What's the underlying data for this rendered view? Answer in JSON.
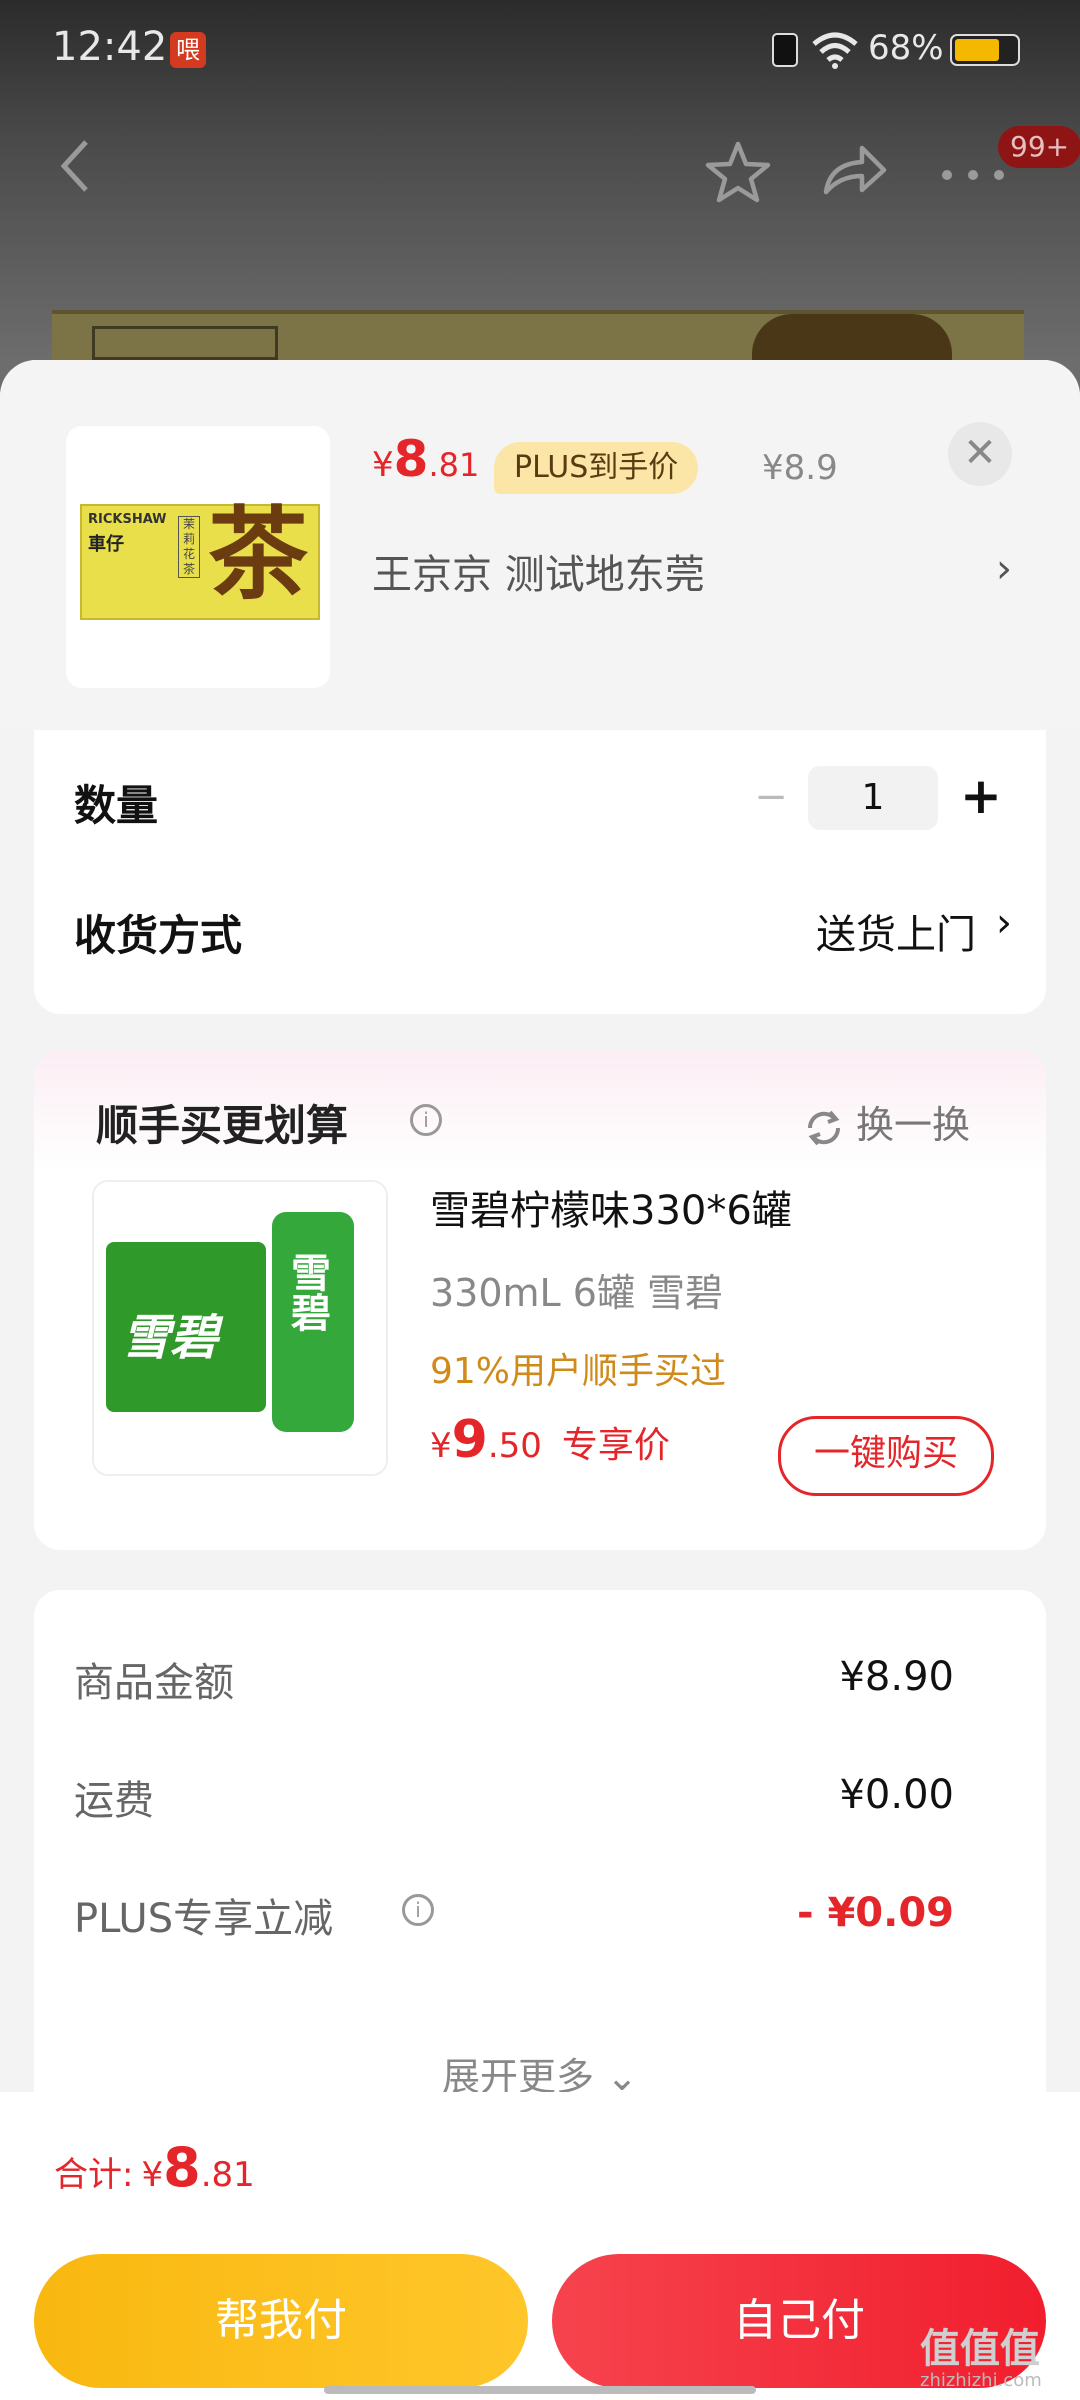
{
  "status_bar": {
    "time": "12:42",
    "app_badge": "喂",
    "battery": "68%"
  },
  "nav": {
    "more_badge": "99+"
  },
  "product": {
    "thumb_brand": "RICKSHAW",
    "thumb_cn": "車仔",
    "thumb_label": "茉莉花茶",
    "thumb_big": "茶",
    "price_currency": "¥",
    "price_int": "8",
    "price_dec": ".81",
    "plus_tag": "PLUS到手价",
    "original_price": "¥8.9",
    "address": "王京京  测试地东莞"
  },
  "quantity": {
    "label": "数量",
    "minus": "−",
    "value": "1",
    "plus": "+"
  },
  "delivery": {
    "label": "收货方式",
    "value": "送货上门"
  },
  "recommend": {
    "title": "顺手买更划算",
    "swap": "换一换",
    "pack_text": "雪碧",
    "can_text": "雪碧",
    "name": "雪碧柠檬味330*6罐",
    "spec": "330mL 6罐      雪碧",
    "social": "91%用户顺手买过",
    "price_currency": "¥",
    "price_int": "9",
    "price_dec": ".50",
    "price_tag": "专享价",
    "buy_button": "一键购买"
  },
  "summary": {
    "rows": [
      {
        "label": "商品金额",
        "value": "¥8.90"
      },
      {
        "label": "运费",
        "value": "¥0.00"
      },
      {
        "label": "PLUS专享立减",
        "value": "- ¥0.09"
      }
    ],
    "expand": "展开更多 ⌄"
  },
  "footer": {
    "total_label": "合计:",
    "total_currency": "¥",
    "total_int": "8",
    "total_dec": ".81",
    "help_pay": "帮我付",
    "self_pay": "自己付"
  },
  "watermark": {
    "main": "值值值",
    "sub": "zhizhizhi.com"
  },
  "colors": {
    "accent_red": "#e4262a",
    "gold": "#f9b810",
    "plus_tag_bg": "#fbe6a8"
  }
}
